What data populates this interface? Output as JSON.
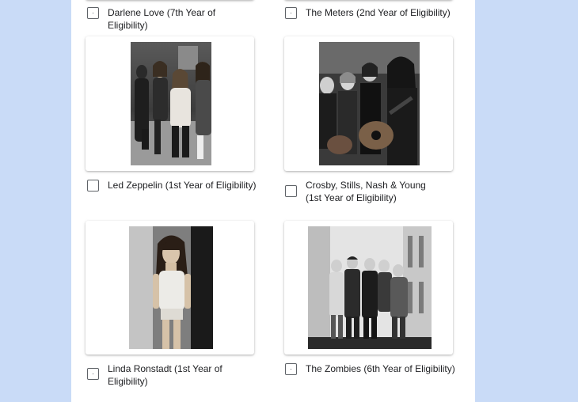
{
  "options": [
    {
      "label": "Darlene Love (7th Year of Eligibility)",
      "checked": false
    },
    {
      "label": "The Meters (2nd Year of Eligibility)",
      "checked": false
    },
    {
      "label": "Led Zeppelin (1st Year of Eligibility)",
      "checked": false
    },
    {
      "label": "Crosby, Stills, Nash & Young (1st Year of Eligibility)",
      "checked": false
    },
    {
      "label": "Linda Ronstadt (1st Year of Eligibility)",
      "checked": false
    },
    {
      "label": "The Zombies (6th Year of Eligibility)",
      "checked": false
    }
  ],
  "colors": {
    "page_background": "#c9dbf7",
    "form_background": "#ffffff",
    "checkbox_border": "#5f6368",
    "text": "#202124"
  }
}
